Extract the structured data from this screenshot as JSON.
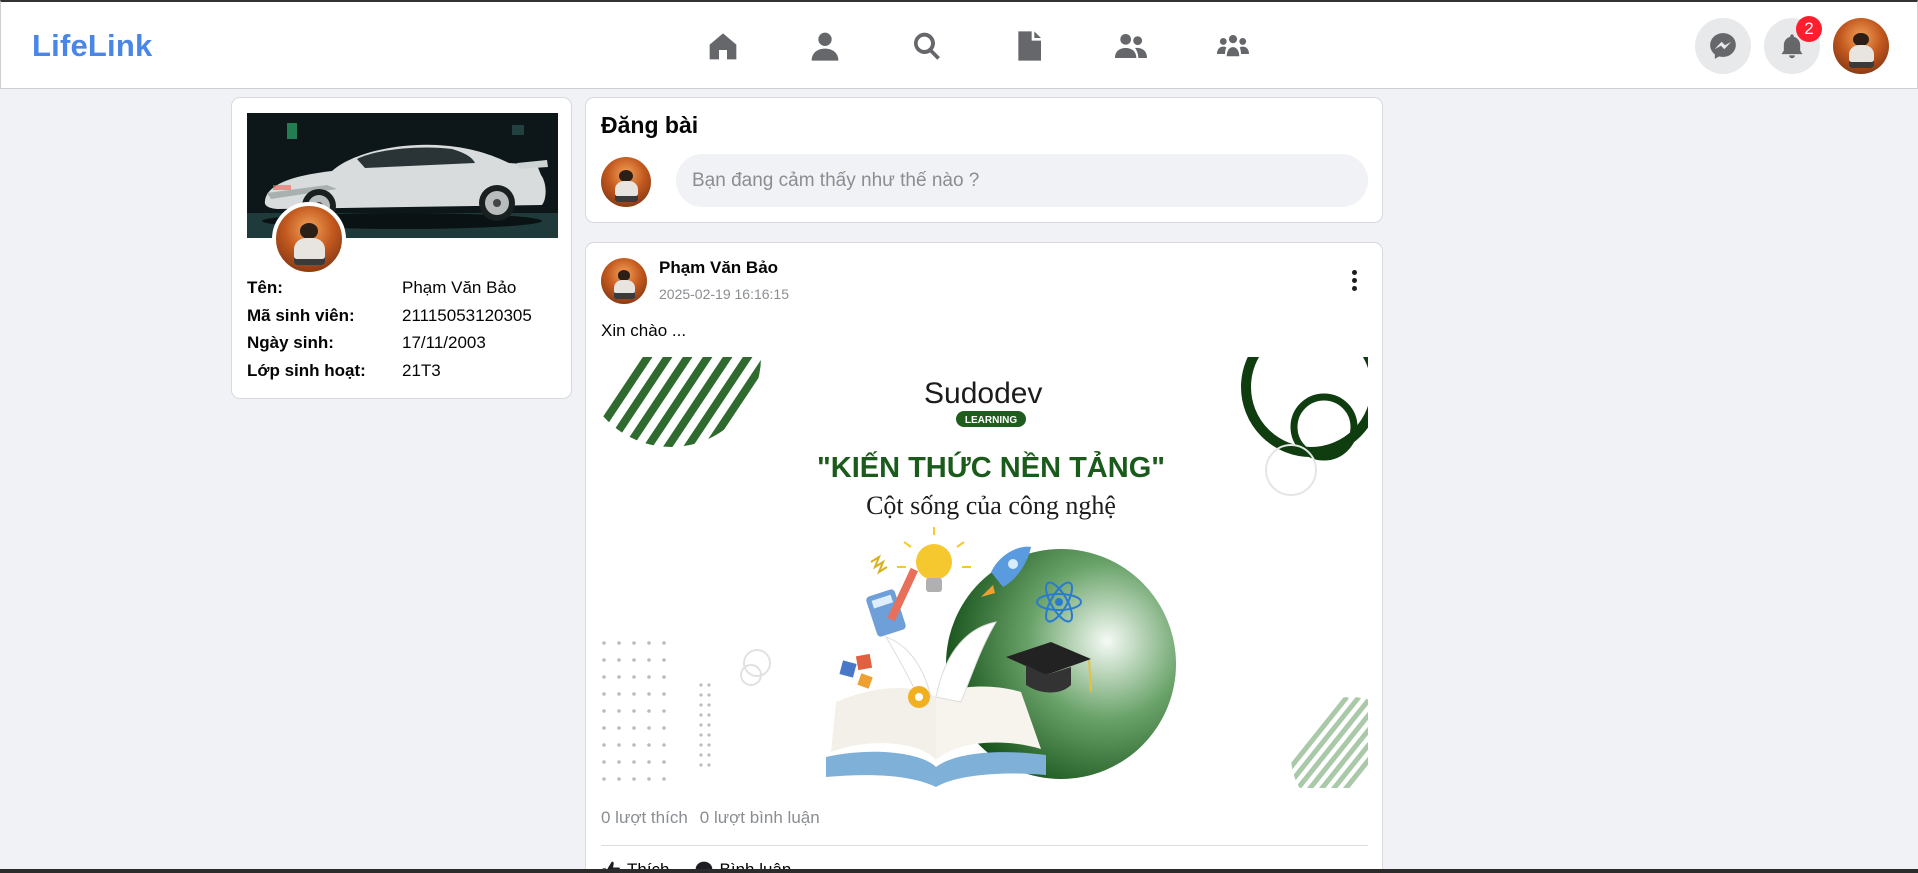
{
  "app": {
    "logo": "LifeLink"
  },
  "nav": [
    {
      "icon": "home-icon"
    },
    {
      "icon": "user-icon"
    },
    {
      "icon": "search-icon"
    },
    {
      "icon": "file-icon"
    },
    {
      "icon": "friends-icon"
    },
    {
      "icon": "groups-icon"
    }
  ],
  "header": {
    "messenger_icon": "messenger-icon",
    "bell_icon": "bell-icon",
    "notification_count": "2"
  },
  "profile": {
    "fields": [
      {
        "label": "Tên:",
        "value": "Phạm Văn Bảo"
      },
      {
        "label": "Mã sinh viên:",
        "value": "21115053120305"
      },
      {
        "label": "Ngày sinh:",
        "value": "17/11/2003"
      },
      {
        "label": "Lớp sinh hoạt:",
        "value": "21T3"
      }
    ]
  },
  "compose": {
    "title": "Đăng bài",
    "placeholder": "Bạn đang cảm thấy như thế nào ?"
  },
  "post": {
    "author": "Phạm Văn Bảo",
    "time": "2025-02-19 16:16:15",
    "text": "Xin chào ...",
    "image": {
      "brand": "Sudodev",
      "brand_tag": "LEARNING",
      "headline": "\"KIẾN THỨC NỀN TẢNG\"",
      "subheadline": "Cột sống của công nghệ"
    },
    "likes": "0 lượt thích",
    "comments": "0 lượt bình luận",
    "like_label": "Thích",
    "comment_label": "Bình luận"
  },
  "colors": {
    "brand": "#4a86e8",
    "accent_green": "#1f5d1f",
    "badge": "#ff1e2d"
  }
}
